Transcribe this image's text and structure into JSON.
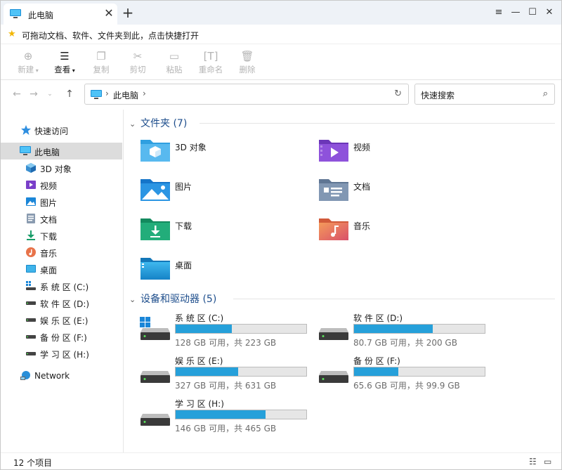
{
  "tab": {
    "title": "此电脑",
    "close": "✕",
    "new_tab": "+"
  },
  "window_controls": {
    "menu": "≡",
    "minimize": "—",
    "maximize": "☐",
    "close": "✕"
  },
  "tip": {
    "text": "可拖动文档、软件、文件夹到此，点击快捷打开"
  },
  "toolbar": {
    "new": "新建",
    "view": "查看",
    "copy": "复制",
    "cut": "剪切",
    "paste": "粘贴",
    "rename": "重命名",
    "delete": "删除"
  },
  "address": {
    "crumb": "此电脑",
    "search_placeholder": "快速搜索"
  },
  "sidebar": {
    "items": [
      {
        "label": "快速访问",
        "icon": "star-icon"
      },
      {
        "label": "此电脑",
        "icon": "computer-icon"
      },
      {
        "label": "3D 对象",
        "icon": "3d-objects-icon"
      },
      {
        "label": "视频",
        "icon": "video-icon"
      },
      {
        "label": "图片",
        "icon": "picture-icon"
      },
      {
        "label": "文档",
        "icon": "document-icon"
      },
      {
        "label": "下载",
        "icon": "download-icon"
      },
      {
        "label": "音乐",
        "icon": "music-icon"
      },
      {
        "label": "桌面",
        "icon": "desktop-icon"
      },
      {
        "label": "系 统 区 (C:)",
        "icon": "drive-icon"
      },
      {
        "label": "软 件 区 (D:)",
        "icon": "drive-icon"
      },
      {
        "label": "娱 乐 区 (E:)",
        "icon": "drive-icon"
      },
      {
        "label": "备 份 区 (F:)",
        "icon": "drive-icon"
      },
      {
        "label": "学 习 区 (H:)",
        "icon": "drive-icon"
      },
      {
        "label": "Network",
        "icon": "network-icon"
      }
    ]
  },
  "groups": {
    "folders_title": "文件夹 (7)",
    "drives_title": "设备和驱动器 (5)"
  },
  "folders": [
    {
      "label": "3D 对象",
      "icon": "3d-objects-folder-icon"
    },
    {
      "label": "视频",
      "icon": "video-folder-icon"
    },
    {
      "label": "图片",
      "icon": "picture-folder-icon"
    },
    {
      "label": "文档",
      "icon": "document-folder-icon"
    },
    {
      "label": "下载",
      "icon": "download-folder-icon"
    },
    {
      "label": "音乐",
      "icon": "music-folder-icon"
    },
    {
      "label": "桌面",
      "icon": "desktop-folder-icon"
    }
  ],
  "drives": [
    {
      "name": "系 统 区 (C:)",
      "info": "128 GB 可用，共 223 GB",
      "used_fraction": 0.43
    },
    {
      "name": "软 件 区 (D:)",
      "info": "80.7 GB 可用，共 200 GB",
      "used_fraction": 0.6
    },
    {
      "name": "娱 乐 区 (E:)",
      "info": "327 GB 可用，共 631 GB",
      "used_fraction": 0.48
    },
    {
      "name": "备 份 区 (F:)",
      "info": "65.6 GB 可用，共 99.9 GB",
      "used_fraction": 0.34
    },
    {
      "name": "学 习 区 (H:)",
      "info": "146 GB 可用，共 465 GB",
      "used_fraction": 0.69
    }
  ],
  "status": {
    "count": "12 个项目"
  },
  "colors": {
    "accent": "#26a0da",
    "group_title": "#1e4e8c",
    "selected_bg": "#dcdcdc"
  }
}
